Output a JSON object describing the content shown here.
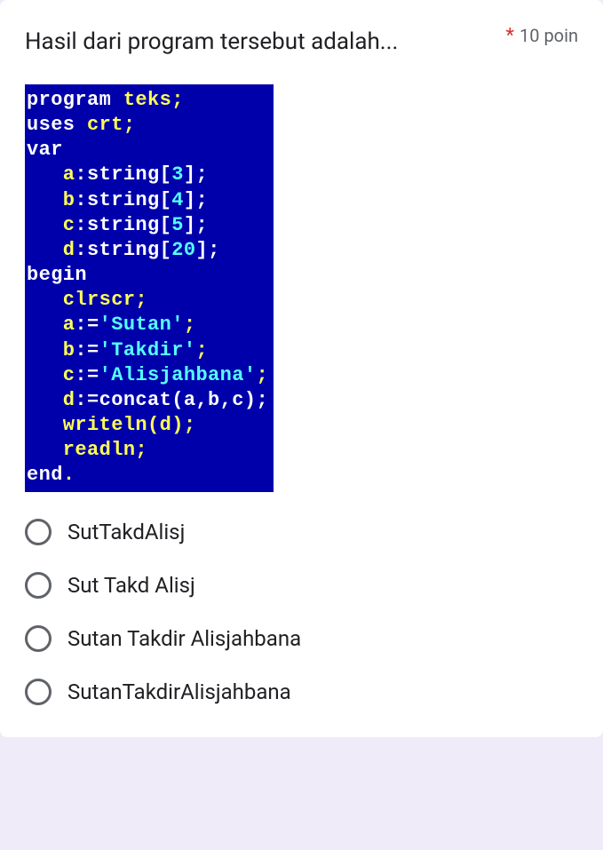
{
  "question": {
    "text": "Hasil dari program tersebut adalah...",
    "required_mark": "*",
    "points": "10 poin"
  },
  "code": {
    "l1_a": "program",
    "l1_b": " teks",
    "l1_c": ";",
    "l2_a": "uses",
    "l2_b": " crt",
    "l2_c": ";",
    "l3_a": "var",
    "l4_a": "   a",
    "l4_b": ":string[",
    "l4_c": "3",
    "l4_d": "];",
    "l5_a": "   b",
    "l5_b": ":string[",
    "l5_c": "4",
    "l5_d": "];",
    "l6_a": "   c",
    "l6_b": ":string[",
    "l6_c": "5",
    "l6_d": "];",
    "l7_a": "   d",
    "l7_b": ":string[",
    "l7_c": "20",
    "l7_d": "];",
    "l8_a": "begin",
    "l9_a": "   clrscr",
    "l9_b": ";",
    "l10_a": "   a",
    "l10_b": ":=",
    "l10_c": "'Sutan'",
    "l10_d": ";",
    "l11_a": "   b",
    "l11_b": ":=",
    "l11_c": "'Takdir'",
    "l11_d": ";",
    "l12_a": "   c",
    "l12_b": ":=",
    "l12_c": "'Alisjahbana'",
    "l12_d": ";",
    "l13_a": "   d",
    "l13_b": ":=concat(a,b,c);",
    "l14_a": "   writeln(d)",
    "l14_b": ";",
    "l15_a": "   readln",
    "l15_b": ";",
    "l16_a": "end",
    "l16_b": "."
  },
  "options": [
    {
      "label": "SutTakdAlisj"
    },
    {
      "label": "Sut Takd Alisj"
    },
    {
      "label": "Sutan Takdir Alisjahbana"
    },
    {
      "label": "SutanTakdirAlisjahbana"
    }
  ]
}
